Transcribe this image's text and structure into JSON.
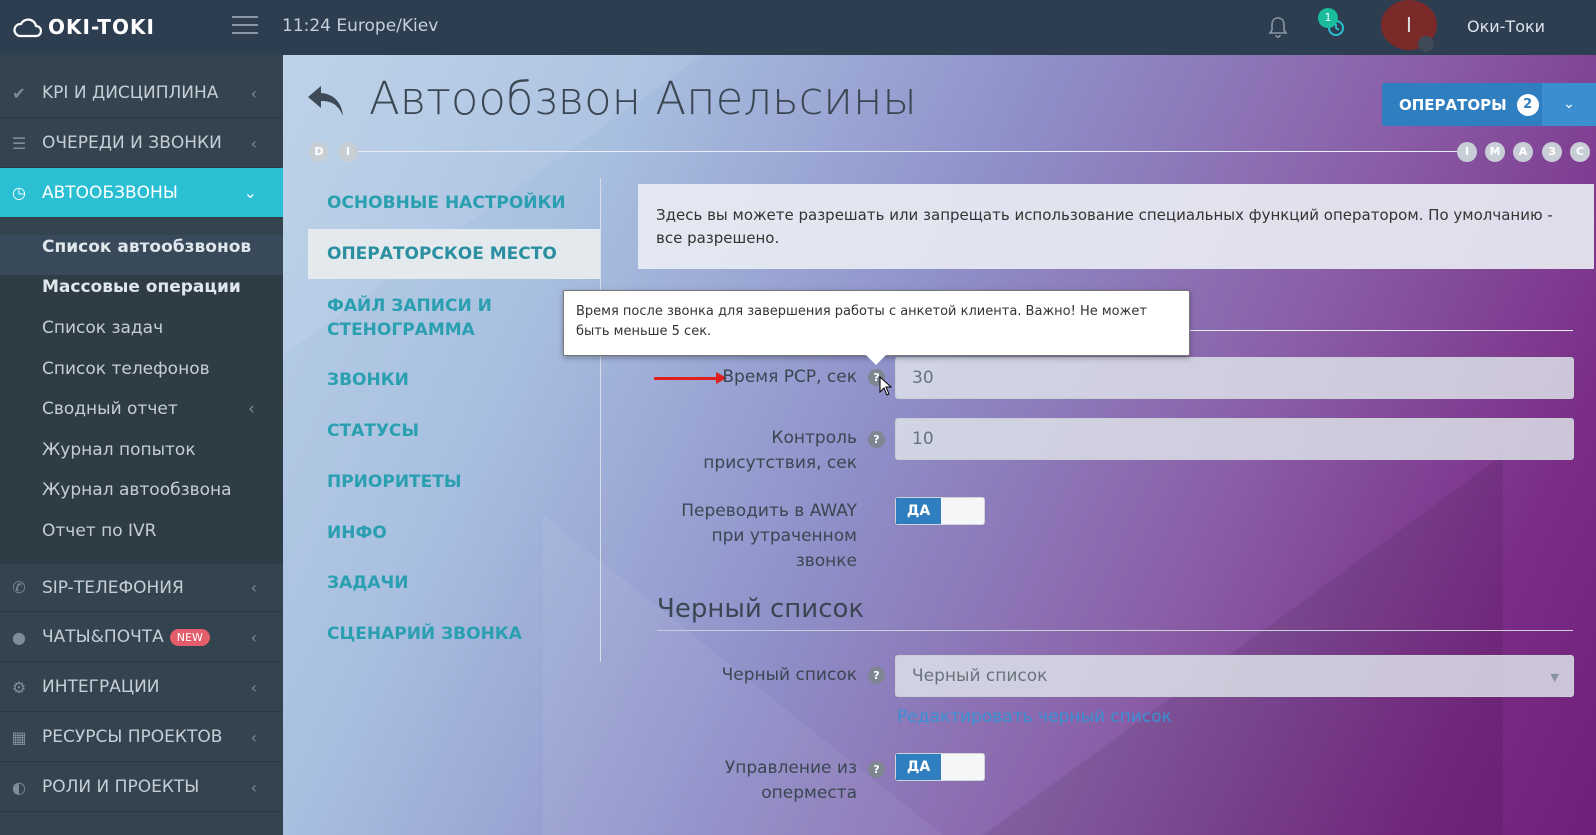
{
  "topbar": {
    "logo_text": "OKI-TOKI",
    "clock": "11:24  Europe/Kiev",
    "history_badge": "1",
    "avatar_initial": "I",
    "username": "Оки-Токи"
  },
  "sidebar": {
    "items": [
      {
        "label": "KPI И ДИСЦИПЛИНА",
        "icon": "check-icon"
      },
      {
        "label": "ОЧЕРЕДИ И ЗВОНКИ",
        "icon": "list-icon"
      },
      {
        "label": "АВТООБЗВОНЫ",
        "icon": "clock-icon"
      },
      {
        "label": "SIP-ТЕЛЕФОНИЯ",
        "icon": "phone-icon"
      },
      {
        "label": "ЧАТЫ&ПОЧТА",
        "icon": "chat-icon",
        "badge": "NEW"
      },
      {
        "label": "ИНТЕГРАЦИИ",
        "icon": "gears-icon"
      },
      {
        "label": "РЕСУРСЫ ПРОЕКТОВ",
        "icon": "grid-icon"
      },
      {
        "label": "РОЛИ И ПРОЕКТЫ",
        "icon": "toggle-icon"
      }
    ],
    "submenu": [
      "Список автообзвонов",
      "Массовые операции",
      "Список задач",
      "Список телефонов",
      "Сводный отчет",
      "Журнал попыток",
      "Журнал автообзвона",
      "Отчет по IVR"
    ]
  },
  "header": {
    "title": "Автообзвон Апельсины",
    "operators_label": "ОПЕРАТОРЫ",
    "operators_count": "2",
    "timeline_left": [
      "D",
      "I"
    ],
    "timeline_right": [
      "I",
      "M",
      "A",
      "З",
      "C"
    ]
  },
  "tabs": [
    "ОСНОВНЫЕ НАСТРОЙКИ",
    "ОПЕРАТОРСКОЕ МЕСТО",
    "ФАЙЛ ЗАПИСИ И СТЕНОГРАММА",
    "ЗВОНКИ",
    "СТАТУСЫ",
    "ПРИОРИТЕТЫ",
    "ИНФО",
    "ЗАДАЧИ",
    "СЦЕНАРИЙ ЗВОНКА"
  ],
  "active_tab": "ОПЕРАТОРСКОЕ МЕСТО",
  "info_text": "Здесь вы можете разрешать или запрещать использование специальных функций оператором. По умолчанию - все разрешено.",
  "tooltip_text": "Время после звонка для завершения работы с анкетой клиента. Важно! Не может быть меньше 5 сек.",
  "form": {
    "pcp_label": "Время РСР, сек",
    "pcp_value": "30",
    "presence_label": "Контроль присутствия, сек",
    "presence_value": "10",
    "away_label": "Переводить в AWAY при утраченном звонке",
    "away_toggle": "ДА",
    "blacklist_section": "Черный список",
    "blacklist_label": "Черный список",
    "blacklist_value": "Черный список",
    "blacklist_edit_link": "Редактировать черный список",
    "control_label": "Управление из оперместа",
    "control_toggle": "ДА"
  },
  "colors": {
    "accent": "#2bbfd3",
    "primary_button": "#2f7fc0",
    "sidebar": "#34444f",
    "topbar": "#2c3e50",
    "badge_new": "#e35d6a",
    "annotation_arrow": "#e0201e"
  }
}
